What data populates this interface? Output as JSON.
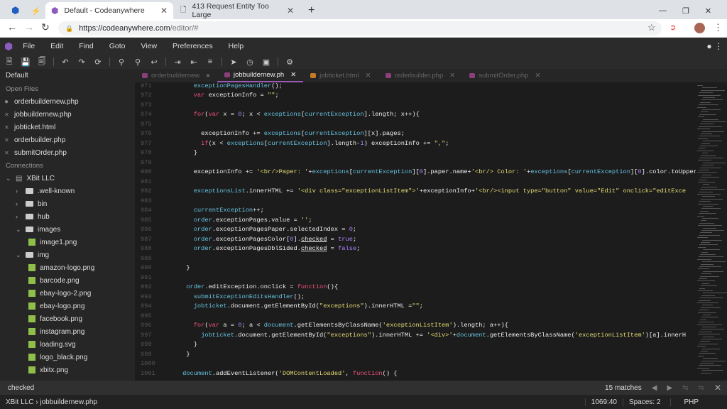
{
  "browser": {
    "tabs": [
      {
        "title": "Default - Codeanywhere",
        "active": true
      },
      {
        "title": "413 Request Entity Too Large",
        "active": false
      }
    ],
    "url_host": "https://codeanywhere.com",
    "url_path": "/editor/#"
  },
  "menu": [
    "File",
    "Edit",
    "Find",
    "Goto",
    "View",
    "Preferences",
    "Help"
  ],
  "toolbar_icons": [
    "new-file-icon",
    "save-icon",
    "save-all-icon",
    "undo-icon",
    "redo-icon",
    "refresh-icon",
    "search-icon",
    "search-replace-icon",
    "wrap-icon",
    "indent-icon",
    "outdent-icon",
    "format-icon",
    "deploy-icon",
    "history-icon",
    "preview-icon",
    "gear-icon"
  ],
  "sidebar": {
    "workspace": "Default",
    "open_files_label": "Open Files",
    "open_files": [
      "orderbuildernew.php",
      "jobbuildernew.php",
      "jobticket.html",
      "orderbuilder.php",
      "submitOrder.php"
    ],
    "connections_label": "Connections",
    "tree": [
      {
        "name": "XBit LLC",
        "type": "server",
        "depth": 0,
        "open": true
      },
      {
        "name": ".well-known",
        "type": "folder",
        "depth": 1
      },
      {
        "name": "bin",
        "type": "folder",
        "depth": 1
      },
      {
        "name": "hub",
        "type": "folder",
        "depth": 1
      },
      {
        "name": "images",
        "type": "folder",
        "depth": 1,
        "open": true
      },
      {
        "name": "image1.png",
        "type": "image",
        "depth": 2
      },
      {
        "name": "img",
        "type": "folder",
        "depth": 1,
        "open": true
      },
      {
        "name": "amazon-logo.png",
        "type": "image",
        "depth": 2
      },
      {
        "name": "barcode.png",
        "type": "image",
        "depth": 2
      },
      {
        "name": "ebay-logo-2.png",
        "type": "image",
        "depth": 2
      },
      {
        "name": "ebay-logo.png",
        "type": "image",
        "depth": 2
      },
      {
        "name": "facebook.png",
        "type": "image",
        "depth": 2
      },
      {
        "name": "instagram.png",
        "type": "image",
        "depth": 2
      },
      {
        "name": "loading.svg",
        "type": "image",
        "depth": 2
      },
      {
        "name": "logo_black.png",
        "type": "image",
        "depth": 2
      },
      {
        "name": "xbitx.png",
        "type": "image",
        "depth": 2
      }
    ]
  },
  "editor_tabs": [
    {
      "label": "orderbuildernew",
      "modified": true
    },
    {
      "label": "jobbuildernew.ph",
      "active": true
    },
    {
      "label": "jobticket.html"
    },
    {
      "label": "orderbuilder.php"
    },
    {
      "label": "submitOrder.php"
    }
  ],
  "code": [
    {
      "n": "971",
      "t": [
        [
          "p",
          "        "
        ],
        [
          "v",
          "exceptionPagesHandler"
        ],
        [
          "p",
          "();"
        ]
      ]
    },
    {
      "n": "972",
      "t": [
        [
          "p",
          "        "
        ],
        [
          "k",
          "var"
        ],
        [
          "p",
          " exceptionInfo = "
        ],
        [
          "s",
          "\"\""
        ],
        [
          "p",
          ";"
        ]
      ]
    },
    {
      "n": "973",
      "t": []
    },
    {
      "n": "974",
      "t": [
        [
          "p",
          "        "
        ],
        [
          "k",
          "for"
        ],
        [
          "p",
          "("
        ],
        [
          "k",
          "var"
        ],
        [
          "p",
          " x = "
        ],
        [
          "n",
          "0"
        ],
        [
          "p",
          "; x < "
        ],
        [
          "v",
          "exceptions"
        ],
        [
          "p",
          "["
        ],
        [
          "v",
          "currentException"
        ],
        [
          "p",
          "].length; x++){"
        ]
      ]
    },
    {
      "n": "975",
      "t": []
    },
    {
      "n": "976",
      "t": [
        [
          "p",
          "          exceptionInfo += "
        ],
        [
          "v",
          "exceptions"
        ],
        [
          "p",
          "["
        ],
        [
          "v",
          "currentException"
        ],
        [
          "p",
          "][x].pages;"
        ]
      ]
    },
    {
      "n": "977",
      "t": [
        [
          "p",
          "          "
        ],
        [
          "k",
          "if"
        ],
        [
          "p",
          "(x < "
        ],
        [
          "v",
          "exceptions"
        ],
        [
          "p",
          "["
        ],
        [
          "v",
          "currentException"
        ],
        [
          "p",
          "].length-"
        ],
        [
          "n",
          "1"
        ],
        [
          "p",
          ") exceptionInfo += "
        ],
        [
          "s",
          "\",\""
        ],
        [
          "p",
          ";"
        ]
      ]
    },
    {
      "n": "978",
      "t": [
        [
          "p",
          "        }"
        ]
      ]
    },
    {
      "n": "979",
      "t": []
    },
    {
      "n": "980",
      "t": [
        [
          "p",
          "        exceptionInfo += "
        ],
        [
          "s",
          "'<br/>Paper: '"
        ],
        [
          "p",
          "+"
        ],
        [
          "v",
          "exceptions"
        ],
        [
          "p",
          "["
        ],
        [
          "v",
          "currentException"
        ],
        [
          "p",
          "]["
        ],
        [
          "n",
          "0"
        ],
        [
          "p",
          "].paper.name+"
        ],
        [
          "s",
          "'<br/> Color: '"
        ],
        [
          "p",
          "+"
        ],
        [
          "v",
          "exceptions"
        ],
        [
          "p",
          "["
        ],
        [
          "v",
          "currentException"
        ],
        [
          "p",
          "]["
        ],
        [
          "n",
          "0"
        ],
        [
          "p",
          "].color.toUpperCase()"
        ]
      ]
    },
    {
      "n": "981",
      "t": []
    },
    {
      "n": "982",
      "t": [
        [
          "p",
          "        "
        ],
        [
          "v",
          "exceptionsList"
        ],
        [
          "p",
          ".innerHTML += "
        ],
        [
          "s",
          "'<div class=\"exceptionListItem\">'"
        ],
        [
          "p",
          "+exceptionInfo+"
        ],
        [
          "s",
          "'<br/><input type=\"button\" value=\"Edit\" onclick=\"editExce"
        ]
      ]
    },
    {
      "n": "983",
      "t": []
    },
    {
      "n": "984",
      "t": [
        [
          "p",
          "        "
        ],
        [
          "v",
          "currentException"
        ],
        [
          "p",
          "++;"
        ]
      ]
    },
    {
      "n": "985",
      "t": [
        [
          "p",
          "        "
        ],
        [
          "v",
          "order"
        ],
        [
          "p",
          ".exceptionPages.value = "
        ],
        [
          "s",
          "''"
        ],
        [
          "p",
          ";"
        ]
      ]
    },
    {
      "n": "986",
      "t": [
        [
          "p",
          "        "
        ],
        [
          "v",
          "order"
        ],
        [
          "p",
          ".exceptionPagesPaper.selectedIndex = "
        ],
        [
          "n",
          "0"
        ],
        [
          "p",
          ";"
        ]
      ]
    },
    {
      "n": "987",
      "t": [
        [
          "p",
          "        "
        ],
        [
          "v",
          "order"
        ],
        [
          "p",
          ".exceptionPagesColor["
        ],
        [
          "n",
          "0"
        ],
        [
          "p",
          "]."
        ],
        [
          "u",
          "checked"
        ],
        [
          "p",
          " = "
        ],
        [
          "n",
          "true"
        ],
        [
          "p",
          ";"
        ]
      ]
    },
    {
      "n": "988",
      "t": [
        [
          "p",
          "        "
        ],
        [
          "v",
          "order"
        ],
        [
          "p",
          ".exceptionPagesDblSided."
        ],
        [
          "u",
          "checked"
        ],
        [
          "p",
          " = "
        ],
        [
          "n",
          "false"
        ],
        [
          "p",
          ";"
        ]
      ]
    },
    {
      "n": "989",
      "t": []
    },
    {
      "n": "990",
      "t": [
        [
          "p",
          "      }"
        ]
      ]
    },
    {
      "n": "991",
      "t": []
    },
    {
      "n": "992",
      "t": [
        [
          "p",
          "      "
        ],
        [
          "v",
          "order"
        ],
        [
          "p",
          ".editException.onclick = "
        ],
        [
          "k",
          "function"
        ],
        [
          "p",
          "(){"
        ]
      ]
    },
    {
      "n": "993",
      "t": [
        [
          "p",
          "        "
        ],
        [
          "v",
          "submitExceptionEditsHandler"
        ],
        [
          "p",
          "();"
        ]
      ]
    },
    {
      "n": "994",
      "t": [
        [
          "p",
          "        "
        ],
        [
          "v",
          "jobticket"
        ],
        [
          "p",
          ".document.getElementById("
        ],
        [
          "s",
          "\"exceptions\""
        ],
        [
          "p",
          ").innerHTML ="
        ],
        [
          "s",
          "\"\""
        ],
        [
          "p",
          ";"
        ]
      ]
    },
    {
      "n": "995",
      "t": []
    },
    {
      "n": "996",
      "t": [
        [
          "p",
          "        "
        ],
        [
          "k",
          "for"
        ],
        [
          "p",
          "("
        ],
        [
          "k",
          "var"
        ],
        [
          "p",
          " a = "
        ],
        [
          "n",
          "0"
        ],
        [
          "p",
          "; a < "
        ],
        [
          "v",
          "document"
        ],
        [
          "p",
          ".getElementsByClassName("
        ],
        [
          "s",
          "'exceptionListItem'"
        ],
        [
          "p",
          ").length; a++){"
        ]
      ]
    },
    {
      "n": "997",
      "t": [
        [
          "p",
          "          "
        ],
        [
          "v",
          "jobticket"
        ],
        [
          "p",
          ".document.getElementById("
        ],
        [
          "s",
          "\"exceptions\""
        ],
        [
          "p",
          ").innerHTML += "
        ],
        [
          "s",
          "'<div>'"
        ],
        [
          "p",
          "+"
        ],
        [
          "v",
          "document"
        ],
        [
          "p",
          ".getElementsByClassName("
        ],
        [
          "s",
          "'exceptionListItem'"
        ],
        [
          "p",
          ")[a].innerH"
        ]
      ]
    },
    {
      "n": "998",
      "t": [
        [
          "p",
          "        }"
        ]
      ]
    },
    {
      "n": "999",
      "t": [
        [
          "p",
          "      }"
        ]
      ]
    },
    {
      "n": "1000",
      "t": []
    },
    {
      "n": "1001",
      "t": [
        [
          "p",
          "     "
        ],
        [
          "v",
          "document"
        ],
        [
          "p",
          ".addEventListener("
        ],
        [
          "s",
          "'DOMContentLoaded'"
        ],
        [
          "p",
          ", "
        ],
        [
          "k",
          "function"
        ],
        [
          "p",
          "() {"
        ]
      ]
    }
  ],
  "find": {
    "query": "checked",
    "matches": "15 matches"
  },
  "status": {
    "breadcrumb": "XBit LLC › jobbuildernew.php",
    "cursor": "1069:40",
    "spaces": "Spaces: 2",
    "language": "PHP"
  },
  "colors": {
    "accent": "#9b59b6",
    "keyword": "#f2507b",
    "string": "#e6db74",
    "number": "#ae81ff",
    "identifier": "#66c2e0"
  }
}
